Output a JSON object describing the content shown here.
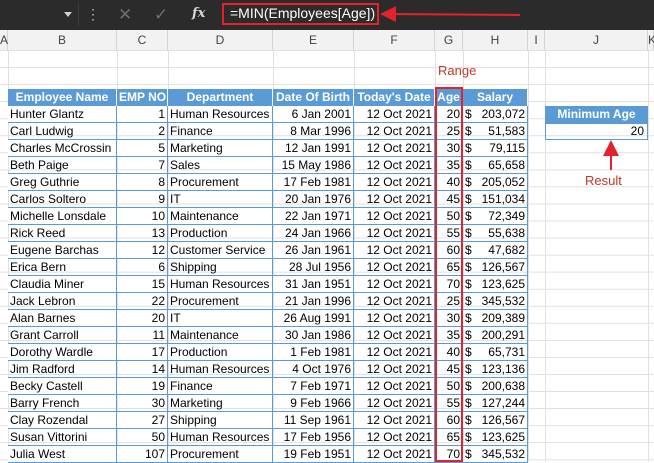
{
  "formula_bar": {
    "formula": "=MIN(Employees[Age])",
    "cancel_icon": "cancel-icon",
    "enter_icon": "check-icon",
    "fx_label": "fx"
  },
  "columns": [
    "A",
    "B",
    "C",
    "D",
    "E",
    "F",
    "G",
    "H",
    "I",
    "J",
    "K"
  ],
  "annotations": {
    "range": "Range",
    "result": "Result"
  },
  "table": {
    "headers": [
      "Employee Name",
      "EMP NO",
      "Department",
      "Date Of Birth",
      "Today's Date",
      "Age",
      "Salary"
    ],
    "rows": [
      [
        "Hunter Glantz",
        "1",
        "Human Resources",
        "6 Jan 2001",
        "12 Oct 2021",
        "20",
        "$",
        "203,072"
      ],
      [
        "Carl Ludwig",
        "2",
        "Finance",
        "8 Mar 1996",
        "12 Oct 2021",
        "25",
        "$",
        "51,583"
      ],
      [
        "Charles McCrossin",
        "5",
        "Marketing",
        "12 Jan 1991",
        "12 Oct 2021",
        "30",
        "$",
        "79,115"
      ],
      [
        "Beth Paige",
        "7",
        "Sales",
        "15 May 1986",
        "12 Oct 2021",
        "35",
        "$",
        "65,658"
      ],
      [
        "Greg Guthrie",
        "8",
        "Procurement",
        "17 Feb 1981",
        "12 Oct 2021",
        "40",
        "$",
        "205,052"
      ],
      [
        "Carlos Soltero",
        "9",
        "IT",
        "20 Jan 1976",
        "12 Oct 2021",
        "45",
        "$",
        "151,034"
      ],
      [
        "Michelle Lonsdale",
        "10",
        "Maintenance",
        "22 Jan 1971",
        "12 Oct 2021",
        "50",
        "$",
        "72,349"
      ],
      [
        "Rick Reed",
        "13",
        "Production",
        "24 Jan 1966",
        "12 Oct 2021",
        "55",
        "$",
        "55,638"
      ],
      [
        "Eugene Barchas",
        "12",
        "Customer Service",
        "26 Jan 1961",
        "12 Oct 2021",
        "60",
        "$",
        "47,682"
      ],
      [
        "Erica Bern",
        "6",
        "Shipping",
        "28 Jul 1956",
        "12 Oct 2021",
        "65",
        "$",
        "126,567"
      ],
      [
        "Claudia Miner",
        "15",
        "Human Resources",
        "31 Jan 1951",
        "12 Oct 2021",
        "70",
        "$",
        "123,625"
      ],
      [
        "Jack Lebron",
        "22",
        "Procurement",
        "21 Jan 1996",
        "12 Oct 2021",
        "25",
        "$",
        "345,532"
      ],
      [
        "Alan Barnes",
        "20",
        "IT",
        "26 Aug 1991",
        "12 Oct 2021",
        "30",
        "$",
        "209,389"
      ],
      [
        "Grant Carroll",
        "11",
        "Maintenance",
        "30 Jan 1986",
        "12 Oct 2021",
        "35",
        "$",
        "200,291"
      ],
      [
        "Dorothy Wardle",
        "17",
        "Production",
        "1 Feb 1981",
        "12 Oct 2021",
        "40",
        "$",
        "65,731"
      ],
      [
        "Jim Radford",
        "14",
        "Human Resources",
        "4 Oct 1976",
        "12 Oct 2021",
        "45",
        "$",
        "123,136"
      ],
      [
        "Becky Castell",
        "19",
        "Finance",
        "7 Feb 1971",
        "12 Oct 2021",
        "50",
        "$",
        "200,638"
      ],
      [
        "Barry French",
        "30",
        "Marketing",
        "9 Feb 1966",
        "12 Oct 2021",
        "55",
        "$",
        "127,244"
      ],
      [
        "Clay Rozendal",
        "27",
        "Shipping",
        "11 Sep 1961",
        "12 Oct 2021",
        "60",
        "$",
        "126,567"
      ],
      [
        "Susan Vittorini",
        "50",
        "Human Resources",
        "17 Feb 1956",
        "12 Oct 2021",
        "65",
        "$",
        "123,625"
      ],
      [
        "Julia West",
        "107",
        "Procurement",
        "19 Feb 1951",
        "12 Oct 2021",
        "70",
        "$",
        "345,532"
      ]
    ]
  },
  "summary": {
    "label": "Minimum Age",
    "value": "20"
  },
  "colors": {
    "header_blue": "#5b9bd5",
    "annotation_red": "#e3222b",
    "formula_bg": "#2b2b2b"
  }
}
